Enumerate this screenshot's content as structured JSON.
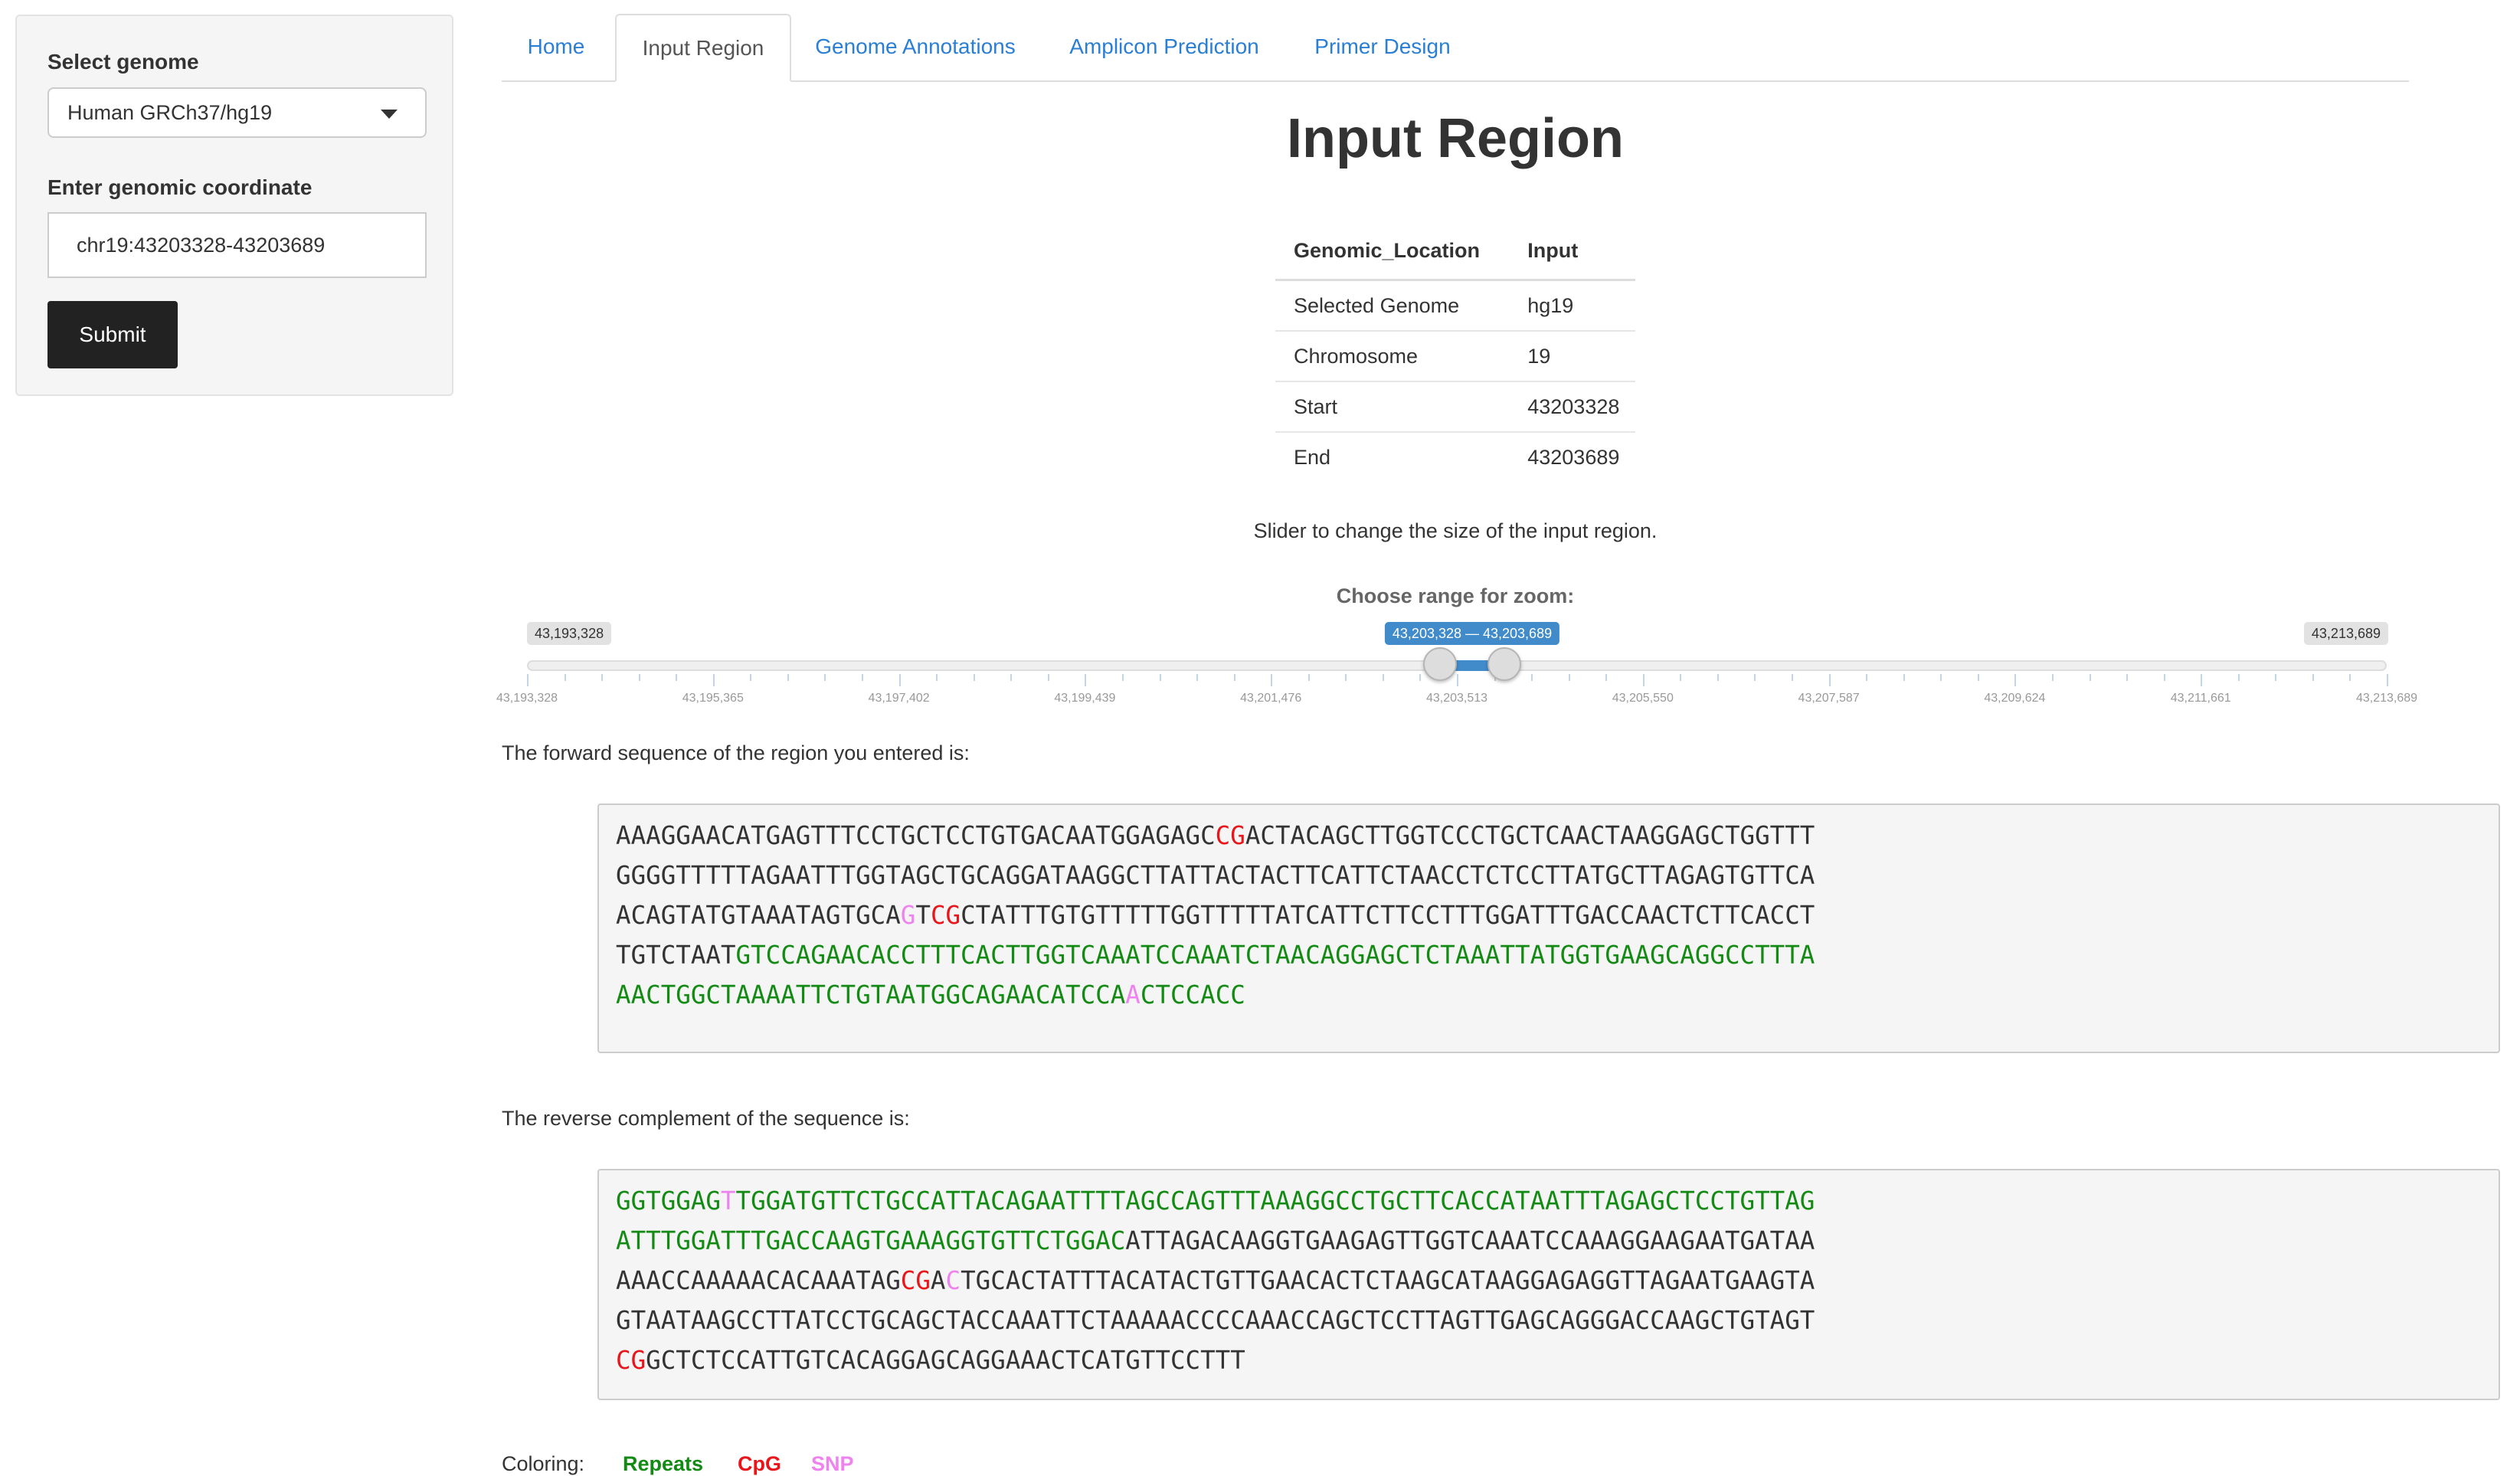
{
  "sidebar": {
    "genome_label": "Select genome",
    "genome_value": "Human GRCh37/hg19",
    "coord_label": "Enter genomic coordinate",
    "coord_value": "chr19:43203328-43203689",
    "submit_label": "Submit"
  },
  "tabs": [
    {
      "label": "Home",
      "active": false
    },
    {
      "label": "Input Region",
      "active": true
    },
    {
      "label": "Genome Annotations",
      "active": false
    },
    {
      "label": "Amplicon Prediction",
      "active": false
    },
    {
      "label": "Primer Design",
      "active": false
    }
  ],
  "main": {
    "title": "Input Region",
    "table": {
      "headers": [
        "Genomic_Location",
        "Input"
      ],
      "rows": [
        [
          "Selected Genome",
          "hg19"
        ],
        [
          "Chromosome",
          "19"
        ],
        [
          "Start",
          "43203328"
        ],
        [
          "End",
          "43203689"
        ]
      ]
    },
    "slider_note": "Slider to change the size of the input region.",
    "slider": {
      "label": "Choose range for zoom:",
      "min_label": "43,193,328",
      "max_label": "43,213,689",
      "value_label": "43,203,328 — 43,203,689",
      "min": 43193328,
      "max": 43213689,
      "from": 43203328,
      "to": 43203689,
      "tick_labels": [
        "43,193,328",
        "43,195,365",
        "43,197,402",
        "43,199,439",
        "43,201,476",
        "43,203,513",
        "43,205,550",
        "43,207,587",
        "43,209,624",
        "43,211,661",
        "43,213,689"
      ]
    },
    "forward_heading": "The forward sequence of the region you entered is:",
    "forward_lines": [
      [
        [
          "n",
          "AAAGGAACATGAGTTTCCTGCTCCTGTGACAATGGAGAGC"
        ],
        [
          "c",
          "CG"
        ],
        [
          "n",
          "ACTACAGCTTGGTCCCTGCTCAACTAAGGAGCTGGTTT"
        ]
      ],
      [
        [
          "n",
          "GGGGTTTTTAGAATTTGGTAGCTGCAGGATAAGGCTTATTACTACTTCATTCTAACCTCTCCTTATGCTTAGAGTGTTCA"
        ]
      ],
      [
        [
          "n",
          "ACAGTATGTAAATAGTGCA"
        ],
        [
          "s",
          "G"
        ],
        [
          "n",
          "T"
        ],
        [
          "c",
          "CG"
        ],
        [
          "n",
          "CTATTTGTGTTTTTGGTTTTTATCATTCTTCCTTTGGATTTGACCAACTCTTCACCT"
        ]
      ],
      [
        [
          "n",
          "TGTCTAAT"
        ],
        [
          "r",
          "GTCCAGAACACCTTTCACTTGGTCAAATCCAAATCTAACAGGAGCTCTAAATTATGGTGAAGCAGGCCTTTA"
        ]
      ],
      [
        [
          "r",
          "AACTGGCTAAAATTCTGTAATGGCAGAACATCCA"
        ],
        [
          "s",
          "A"
        ],
        [
          "r",
          "CTCCACC"
        ]
      ]
    ],
    "reverse_heading": "The reverse complement of the sequence is:",
    "reverse_lines": [
      [
        [
          "r",
          "GGTGGAG"
        ],
        [
          "s",
          "T"
        ],
        [
          "r",
          "TGGATGTTCTGCCATTACAGAATTTTAGCCAGTTTAAAGGCCTGCTTCACCATAATTTAGAGCTCCTGTTAG"
        ]
      ],
      [
        [
          "r",
          "ATTTGGATTTGACCAAGTGAAAGGTGTTCTGGAC"
        ],
        [
          "n",
          "ATTAGACAAGGTGAAGAGTTGGTCAAATCCAAAGGAAGAATGATAA"
        ]
      ],
      [
        [
          "n",
          "AAACCAAAAACACAAATAG"
        ],
        [
          "c",
          "CG"
        ],
        [
          "n",
          "A"
        ],
        [
          "s",
          "C"
        ],
        [
          "n",
          "TGCACTATTTACATACTGTTGAACACTCTAAGCATAAGGAGAGGTTAGAATGAAGTA"
        ]
      ],
      [
        [
          "n",
          "GTAATAAGCCTTATCCTGCAGCTACCAAATTCTAAAAACCCCAAACCAGCTCCTTAGTTGAGCAGGGACCAAGCTGTAGT"
        ]
      ],
      [
        [
          "c",
          "CG"
        ],
        [
          "n",
          "GCTCTCCATTGTCACAGGAGCAGGAAACTCATGTTCCTTT"
        ]
      ]
    ],
    "legend": {
      "label": "Coloring:",
      "repeats": "Repeats",
      "cpg": "CpG",
      "snp": "SNP"
    }
  },
  "colors": {
    "repeats": "#138a13",
    "cpg": "#e8161a",
    "snp": "#ee82ee",
    "tab_link": "#2a7fd4",
    "slider_accent": "#428bca",
    "submit_bg": "#222222"
  },
  "icons": {
    "select_caret": "chevron-down-icon"
  }
}
